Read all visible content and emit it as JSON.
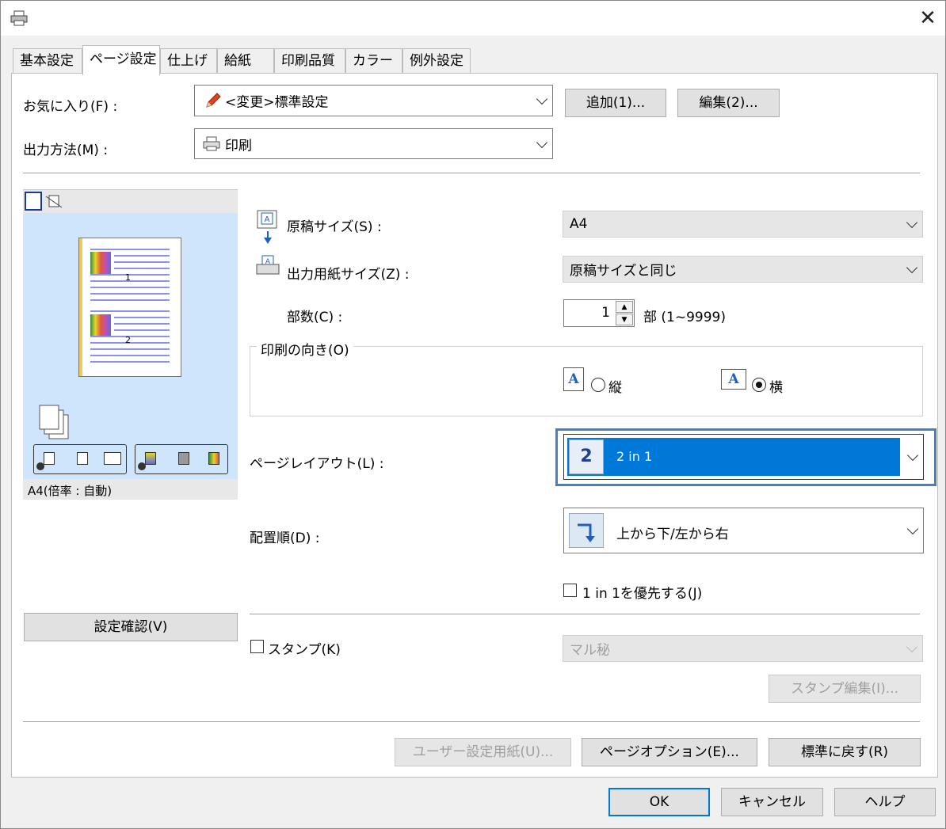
{
  "window": {
    "close_glyph": "✕"
  },
  "tabs": [
    "基本設定",
    "ページ設定",
    "仕上げ",
    "給紙",
    "印刷品質",
    "カラー",
    "例外設定"
  ],
  "favorites": {
    "label": "お気に入り(F) :",
    "value": "<変更>標準設定",
    "add_button": "追加(1)...",
    "edit_button": "編集(2)..."
  },
  "output_method": {
    "label": "出力方法(M) :",
    "value": "印刷"
  },
  "original_size": {
    "label": "原稿サイズ(S) :",
    "value": "A4"
  },
  "output_paper_size": {
    "label": "出力用紙サイズ(Z) :",
    "value": "原稿サイズと同じ"
  },
  "copies": {
    "label": "部数(C) :",
    "value": "1",
    "unit": "部 (1~9999)"
  },
  "orientation": {
    "group_label": "印刷の向き(O)",
    "portrait": "縦",
    "landscape": "横",
    "selected": "landscape",
    "icon_letter": "A"
  },
  "page_layout": {
    "label": "ページレイアウト(L) :",
    "icon_text": "2",
    "value": "2 in 1"
  },
  "page_order": {
    "label": "配置順(D) :",
    "value": "上から下/左から右"
  },
  "prefer_1in1": {
    "label": "1 in 1を優先する(J)",
    "checked": false
  },
  "stamp": {
    "label": "スタンプ(K)",
    "checked": false,
    "value": "マル秘",
    "edit_button": "スタンプ編集(I)..."
  },
  "preview": {
    "page_numbers": [
      "1",
      "2"
    ],
    "caption": "A4(倍率 : 自動)"
  },
  "confirm_button": "設定確認(V)",
  "bottom_buttons": {
    "user_paper": "ユーザー設定用紙(U)...",
    "page_options": "ページオプション(E)...",
    "restore_defaults": "標準に戻す(R)"
  },
  "dialog_buttons": {
    "ok": "OK",
    "cancel": "キャンセル",
    "help": "ヘルプ"
  },
  "colors": {
    "accent": "#0078d7",
    "preview_bg": "#cfe5fb",
    "focus_ring": "#4a7ec4"
  }
}
